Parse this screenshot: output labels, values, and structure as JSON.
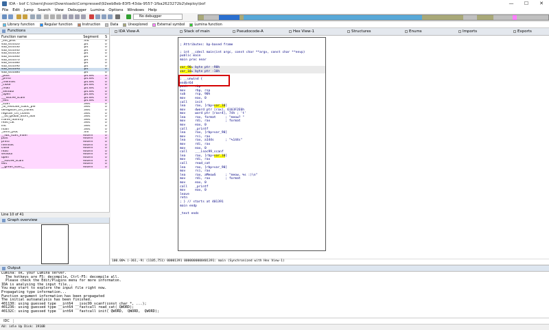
{
  "window": {
    "title": "IDA - bof C:\\Users\\jhoon\\Downloads\\Compressed\\92eeb8eb-83f5-43da-9557-1fba2623272b2\\deploy\\bof",
    "minimize": "—",
    "maximize": "☐",
    "close": "✕"
  },
  "menu": [
    "File",
    "Edit",
    "Jump",
    "Search",
    "View",
    "Debugger",
    "Lumina",
    "Options",
    "Windows",
    "Help"
  ],
  "debugger_select": "No debugger",
  "legend": [
    {
      "label": "Library function",
      "color": "#59c3f0"
    },
    {
      "label": "Regular function",
      "color": "#1e90ff"
    },
    {
      "label": "Instruction",
      "color": "#c08060"
    },
    {
      "label": "Data",
      "color": "#c0c0c0"
    },
    {
      "label": "Unexplored",
      "color": "#a8a878"
    },
    {
      "label": "External symbol",
      "color": "#ff80ff"
    },
    {
      "label": "Lumina function",
      "color": "#30d030"
    }
  ],
  "functions": {
    "title": "Functions",
    "columns": [
      "Function name",
      "Segment",
      "S"
    ],
    "rows": [
      {
        "name": "_init_proc",
        "seg": ".init",
        "pink": false
      },
      {
        "name": "sub_401020",
        "seg": ".plt",
        "pink": false
      },
      {
        "name": "sub_401030",
        "seg": ".plt",
        "pink": false
      },
      {
        "name": "sub_401040",
        "seg": ".plt",
        "pink": false
      },
      {
        "name": "sub_401050",
        "seg": ".plt",
        "pink": false
      },
      {
        "name": "sub_401060",
        "seg": ".plt",
        "pink": false
      },
      {
        "name": "sub_401070",
        "seg": ".plt",
        "pink": false
      },
      {
        "name": "sub_401080",
        "seg": ".plt",
        "pink": false
      },
      {
        "name": "sub_401090",
        "seg": ".plt",
        "pink": false
      },
      {
        "name": "sub_4010A0",
        "seg": ".plt",
        "pink": false
      },
      {
        "name": "sub_4010B0",
        "seg": ".plt",
        "pink": false
      },
      {
        "name": "_puts",
        "seg": ".plt.sec",
        "pink": true
      },
      {
        "name": "_printf",
        "seg": ".plt.sec",
        "pink": true
      },
      {
        "name": "_memset",
        "seg": ".plt.sec",
        "pink": true
      },
      {
        "name": "_close",
        "seg": ".plt.sec",
        "pink": true
      },
      {
        "name": "_read",
        "seg": ".plt.sec",
        "pink": true
      },
      {
        "name": "_setvbuf",
        "seg": ".plt.sec",
        "pink": true
      },
      {
        "name": "_open",
        "seg": ".plt.sec",
        "pink": true
      },
      {
        "name": "___isoc99_scanf",
        "seg": ".plt.sec",
        "pink": true
      },
      {
        "name": "_exit",
        "seg": ".plt.sec",
        "pink": true
      },
      {
        "name": "_start",
        "seg": ".text",
        "pink": false
      },
      {
        "name": "_dl_relocate_static_pie",
        "seg": ".text",
        "pink": false
      },
      {
        "name": "deregister_tm_clones",
        "seg": ".text",
        "pink": false
      },
      {
        "name": "register_tm_clones",
        "seg": ".text",
        "pink": false
      },
      {
        "name": "__do_global_dtors_aux",
        "seg": ".text",
        "pink": false
      },
      {
        "name": "frame_dummy",
        "seg": ".text",
        "pink": false
      },
      {
        "name": "read_cat",
        "seg": ".text",
        "pink": false
      },
      {
        "name": "init",
        "seg": ".text",
        "pink": false
      },
      {
        "name": "main",
        "seg": ".text",
        "pink": false
      },
      {
        "name": "_term_proc",
        "seg": ".fini",
        "pink": false
      },
      {
        "name": "__libc_start_main",
        "seg": "extern",
        "pink": true
      },
      {
        "name": "puts",
        "seg": "extern",
        "pink": true
      },
      {
        "name": "printf",
        "seg": "extern",
        "pink": true
      },
      {
        "name": "memset",
        "seg": "extern",
        "pink": true
      },
      {
        "name": "close",
        "seg": "extern",
        "pink": true
      },
      {
        "name": "read",
        "seg": "extern",
        "pink": true
      },
      {
        "name": "setvbuf",
        "seg": "extern",
        "pink": true
      },
      {
        "name": "open",
        "seg": "extern",
        "pink": true
      },
      {
        "name": "__isoc99_scanf",
        "seg": "extern",
        "pink": true
      },
      {
        "name": "exit",
        "seg": "extern",
        "pink": true
      },
      {
        "name": "__gmon_start__",
        "seg": "extern",
        "pink": true
      }
    ],
    "status": "Line 10 of 41"
  },
  "graph_overview": {
    "title": "Graph overview"
  },
  "tabs": [
    "IDA View-A",
    "Stack of main",
    "Pseudocode-A",
    "Hex View-1",
    "Structures",
    "Enums",
    "Imports",
    "Exports"
  ],
  "code": [
    {
      "t": "",
      "c": "blank"
    },
    {
      "t": "; Attributes: bp-based frame",
      "c": "cm"
    },
    {
      "t": "",
      "c": "blank"
    },
    {
      "t": "; int __cdecl main(int argc, const char **argv, const char **envp)",
      "c": "cm"
    },
    {
      "t": "public main",
      "c": ""
    },
    {
      "t": "main proc near",
      "c": ""
    },
    {
      "t": "",
      "c": "blank"
    },
    {
      "t": "var_90= byte ptr -90h",
      "c": "hl"
    },
    {
      "t": "var_10= byte ptr -10h",
      "c": "hl"
    },
    {
      "t": "",
      "c": "blank"
    },
    {
      "t": "; __unwind {",
      "c": "cm"
    },
    {
      "t": "endbr64",
      "c": ""
    },
    {
      "t": "push    rbp",
      "c": ""
    },
    {
      "t": "mov     rbp, rsp",
      "c": ""
    },
    {
      "t": "sub     rsp, 90h",
      "c": ""
    },
    {
      "t": "mov     eax, 0",
      "c": ""
    },
    {
      "t": "call    init",
      "c": ""
    },
    {
      "t": "lea     rax, [rbp+var_10]",
      "c": ""
    },
    {
      "t": "mov     dword ptr [rax], 6163F2E6h",
      "c": ""
    },
    {
      "t": "mov     word ptr [rax+4], 74h ; 't'",
      "c": ""
    },
    {
      "t": "lea     rax, format     ; \"meow? \"",
      "c": ""
    },
    {
      "t": "mov     rdi, rax        ; format",
      "c": ""
    },
    {
      "t": "mov     eax, 0",
      "c": ""
    },
    {
      "t": "call    _printf",
      "c": ""
    },
    {
      "t": "lea     rax, [rbp+var_90]",
      "c": ""
    },
    {
      "t": "mov     rsi, rax",
      "c": ""
    },
    {
      "t": "lea     rax, a144s      ; \"%144s\"",
      "c": ""
    },
    {
      "t": "mov     rdi, rax",
      "c": ""
    },
    {
      "t": "mov     eax, 0",
      "c": ""
    },
    {
      "t": "call    ___isoc99_scanf",
      "c": ""
    },
    {
      "t": "lea     rax, [rbp+var_10]",
      "c": ""
    },
    {
      "t": "mov     rdi, rax",
      "c": ""
    },
    {
      "t": "call    read_cat",
      "c": ""
    },
    {
      "t": "lea     rax, [rbp+var_90]",
      "c": ""
    },
    {
      "t": "mov     rsi, rax",
      "c": ""
    },
    {
      "t": "lea     rax, aMeowS     ; \"meow, %s :)\\n\"",
      "c": ""
    },
    {
      "t": "mov     rdi, rax        ; format",
      "c": ""
    },
    {
      "t": "mov     eax, 0",
      "c": ""
    },
    {
      "t": "call    _printf",
      "c": ""
    },
    {
      "t": "mov     eax, 0",
      "c": ""
    },
    {
      "t": "leave",
      "c": ""
    },
    {
      "t": "retn",
      "c": ""
    },
    {
      "t": "; } // starts at 401391",
      "c": "cm"
    },
    {
      "t": "main endp",
      "c": ""
    },
    {
      "t": "",
      "c": "blank"
    },
    {
      "t": "_text ends",
      "c": ""
    }
  ],
  "ida_status": "100.00% (-361,-9) (1105,751) 00001391 0000000000401391: main (Synchronized with Hex View-1)",
  "output": {
    "title": "Output",
    "lines": [
      "Lumina: ok, your Lumina server.",
      "  The hotkeys are F5: decompile, Ctrl-F5: decompile all.",
      "  Please check the Edit/Plugins menu for more informaton.",
      "IDA is analysing the input file...",
      "You may start to explore the input file right now.",
      "Propagating type information...",
      "Function argument information has been propagated",
      "The initial autoanalysis has been finished.",
      "401130: using guessed type __int64 __isoc99_scanf(const char *, ...);",
      "401236: using guessed type __int64 __fastcall read_cat(_QWORD);",
      "40132C: using guessed type __int64 __fastcall init(_QWORD, _QWORD, _QWORD);"
    ]
  },
  "idc_label": "IDC",
  "statusbar": "AU:  idle   Up    Disk: 1910B"
}
